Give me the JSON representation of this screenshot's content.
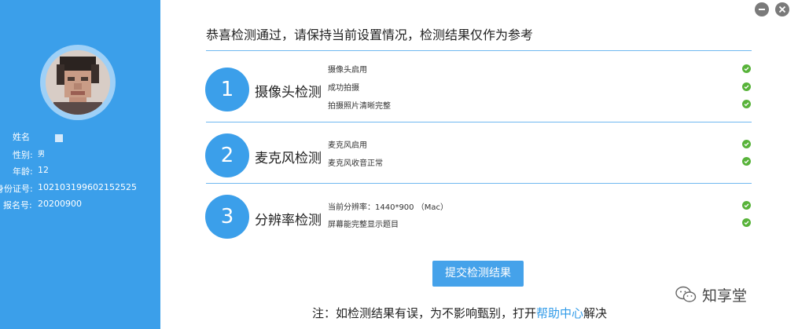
{
  "window": {
    "minimize_icon": "minus-icon",
    "close_icon": "close-icon"
  },
  "profile": {
    "fields": [
      {
        "label": "姓名",
        "value": ""
      },
      {
        "label": "性别:",
        "value": "男"
      },
      {
        "label": "年龄:",
        "value": "12"
      },
      {
        "label": "身份证号:",
        "value": "102103199602152525"
      },
      {
        "label": "报名号:",
        "value": "20200900"
      }
    ]
  },
  "main": {
    "title": "恭喜检测通过，请保持当前设置情况，检测结果仅作为参考",
    "sections": [
      {
        "number": "1",
        "title": "摄像头检测",
        "items": [
          "摄像头启用",
          "成功拍摄",
          "拍摄照片清晰完整"
        ]
      },
      {
        "number": "2",
        "title": "麦克风检测",
        "items": [
          "麦克风启用",
          "麦克风收音正常"
        ]
      },
      {
        "number": "3",
        "title": "分辨率检测",
        "items": [
          "当前分辨率：1440*900 （Mac）",
          "屏幕能完整显示题目"
        ]
      }
    ],
    "submit_label": "提交检测结果",
    "note_prefix": "注：如检测结果有误，为不影响甄别，打开",
    "note_link": "帮助中心",
    "note_suffix": "解决"
  },
  "watermark": {
    "text": "知享堂",
    "icon": "wechat-icon"
  },
  "colors": {
    "accent": "#3b9fea",
    "check": "#58b33a",
    "divider": "#6fb8f0"
  }
}
